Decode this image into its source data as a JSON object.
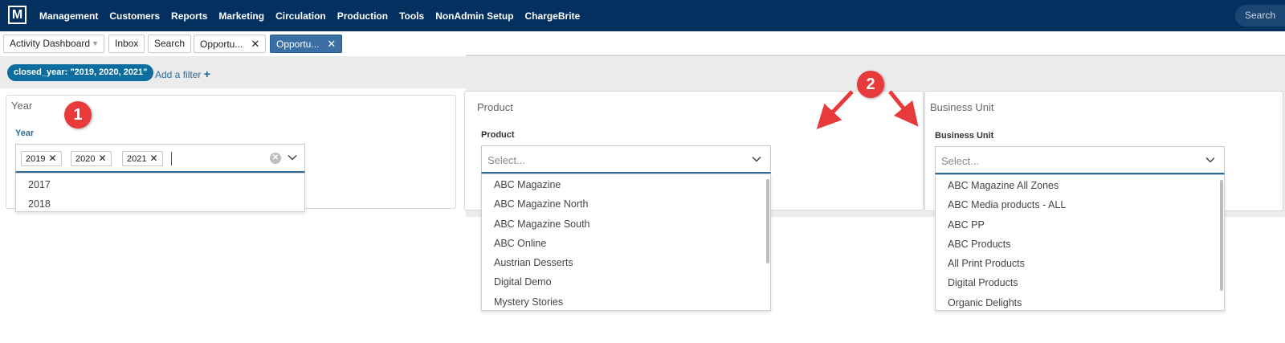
{
  "topnav": {
    "logo": "M",
    "items": [
      "Management",
      "Customers",
      "Reports",
      "Marketing",
      "Circulation",
      "Production",
      "Tools",
      "NonAdmin Setup",
      "ChargeBrite"
    ],
    "search_label": "Search"
  },
  "tabs": [
    {
      "label": "Activity Dashboard"
    },
    {
      "label": "Inbox"
    },
    {
      "label": "Search"
    },
    {
      "label": "Opportu..."
    },
    {
      "label": "Opportu..."
    }
  ],
  "filter": {
    "pill": "closed_year: \"2019, 2020, 2021\"",
    "add_label": "Add a filter"
  },
  "year_panel": {
    "title": "Year",
    "field_label": "Year",
    "chips": [
      "2019",
      "2020",
      "2021"
    ],
    "options": [
      "2017",
      "2018"
    ]
  },
  "product_panel": {
    "title": "Product",
    "field_label": "Product",
    "placeholder": "Select...",
    "options": [
      "ABC Magazine",
      "ABC Magazine North",
      "ABC Magazine South",
      "ABC Online",
      "Austrian Desserts",
      "Digital Demo",
      "Mystery Stories"
    ]
  },
  "bu_panel": {
    "title": "Business Unit",
    "field_label": "Business Unit",
    "placeholder": "Select...",
    "options": [
      "ABC Magazine All Zones",
      "ABC Media products - ALL",
      "ABC PP",
      "ABC Products",
      "All Print Products",
      "Digital Products",
      "Organic Delights"
    ]
  },
  "annotations": {
    "badge1": "1",
    "badge2": "2",
    "color": "#e83a3a"
  },
  "colors": {
    "nav_bg": "#03305f",
    "active_tab": "#3a6fa5",
    "pill": "#0d6d9e",
    "accent": "#2e6c9a"
  }
}
